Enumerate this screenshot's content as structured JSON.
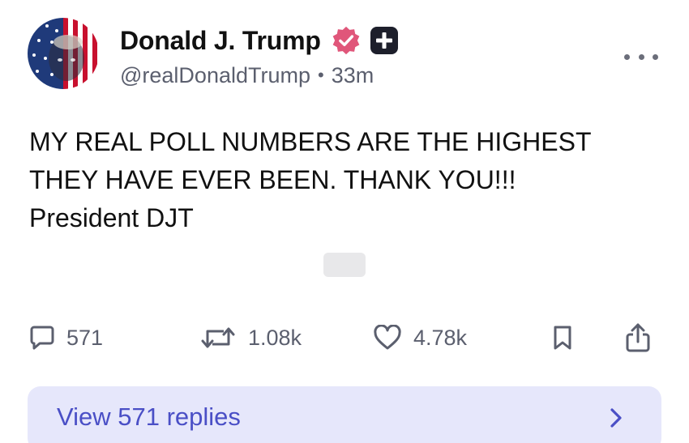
{
  "author": {
    "display_name": "Donald J. Trump",
    "handle": "@realDonaldTrump",
    "separator": "•",
    "time_ago": "33m",
    "verified_badge_icon": "verified-badge-icon",
    "verified_badge_color": "#e0567a",
    "plus_badge_icon": "plus-badge-icon"
  },
  "post": {
    "lines": [
      "MY REAL POLL NUMBERS ARE THE HIGHEST",
      "THEY HAVE EVER BEEN. THANK YOU!!!",
      "President DJT"
    ]
  },
  "actions": {
    "replies": {
      "icon": "reply-icon",
      "count": "571"
    },
    "retruths": {
      "icon": "retruth-icon",
      "count": "1.08k"
    },
    "likes": {
      "icon": "heart-icon",
      "count": "4.78k"
    },
    "bookmark": {
      "icon": "bookmark-icon"
    },
    "share": {
      "icon": "share-icon"
    }
  },
  "view_replies": {
    "label": "View 571 replies",
    "icon": "chevron-right-icon"
  },
  "colors": {
    "text": "#111111",
    "muted": "#5b5f6e",
    "replies_bar_bg": "#e6e7fb",
    "replies_bar_text": "#4a4fc6"
  }
}
